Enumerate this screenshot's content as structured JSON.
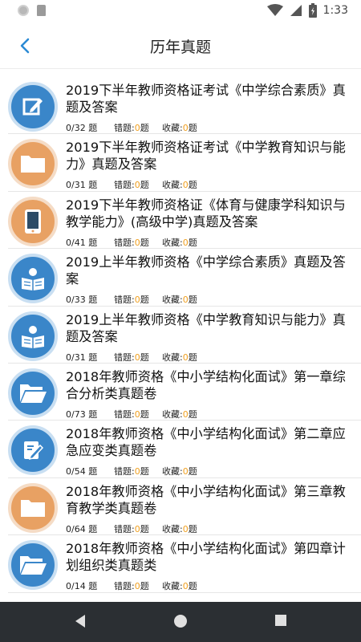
{
  "status_bar": {
    "time": "1:33"
  },
  "header": {
    "title": "历年真题",
    "back_icon": "back-chevron-icon"
  },
  "colors": {
    "accent": "#3a86c9",
    "orange": "#e8a163",
    "count_highlight": "#f0a020",
    "navbar": "#2b2f33"
  },
  "labels": {
    "questions_unit": "题",
    "wrong": "错题:",
    "favorites": "收藏:"
  },
  "items": [
    {
      "title": "2019下半年教师资格证考试《中学综合素质》真题及答案",
      "progress": "0/32",
      "wrong": "0",
      "fav": "0",
      "icon": "edit-icon",
      "color": "blue"
    },
    {
      "title": "2019下半年教师资格证考试《中学教育知识与能力》真题及答案",
      "progress": "0/31",
      "wrong": "0",
      "fav": "0",
      "icon": "folder-icon",
      "color": "orange"
    },
    {
      "title": "2019下半年教师资格证《体育与健康学科知识与教学能力》(高级中学)真题及答案",
      "progress": "0/41",
      "wrong": "0",
      "fav": "0",
      "icon": "phone-icon",
      "color": "orange"
    },
    {
      "title": "2019上半年教师资格《中学综合素质》真题及答案",
      "progress": "0/33",
      "wrong": "0",
      "fav": "0",
      "icon": "reader-icon",
      "color": "blue"
    },
    {
      "title": "2019上半年教师资格《中学教育知识与能力》真题及答案",
      "progress": "0/31",
      "wrong": "0",
      "fav": "0",
      "icon": "reader-icon",
      "color": "blue"
    },
    {
      "title": "2018年教师资格《中小学结构化面试》第一章综合分析类真题卷",
      "progress": "0/73",
      "wrong": "0",
      "fav": "0",
      "icon": "open-folder-icon",
      "color": "blue"
    },
    {
      "title": "2018年教师资格《中小学结构化面试》第二章应急应变类真题卷",
      "progress": "0/54",
      "wrong": "0",
      "fav": "0",
      "icon": "edit-note-icon",
      "color": "blue"
    },
    {
      "title": "2018年教师资格《中小学结构化面试》第三章教育教学类真题卷",
      "progress": "0/64",
      "wrong": "0",
      "fav": "0",
      "icon": "folder-icon",
      "color": "orange"
    },
    {
      "title": "2018年教师资格《中小学结构化面试》第四章计划组织类真题类",
      "progress": "0/14",
      "wrong": "0",
      "fav": "0",
      "icon": "open-folder-icon",
      "color": "blue"
    }
  ]
}
